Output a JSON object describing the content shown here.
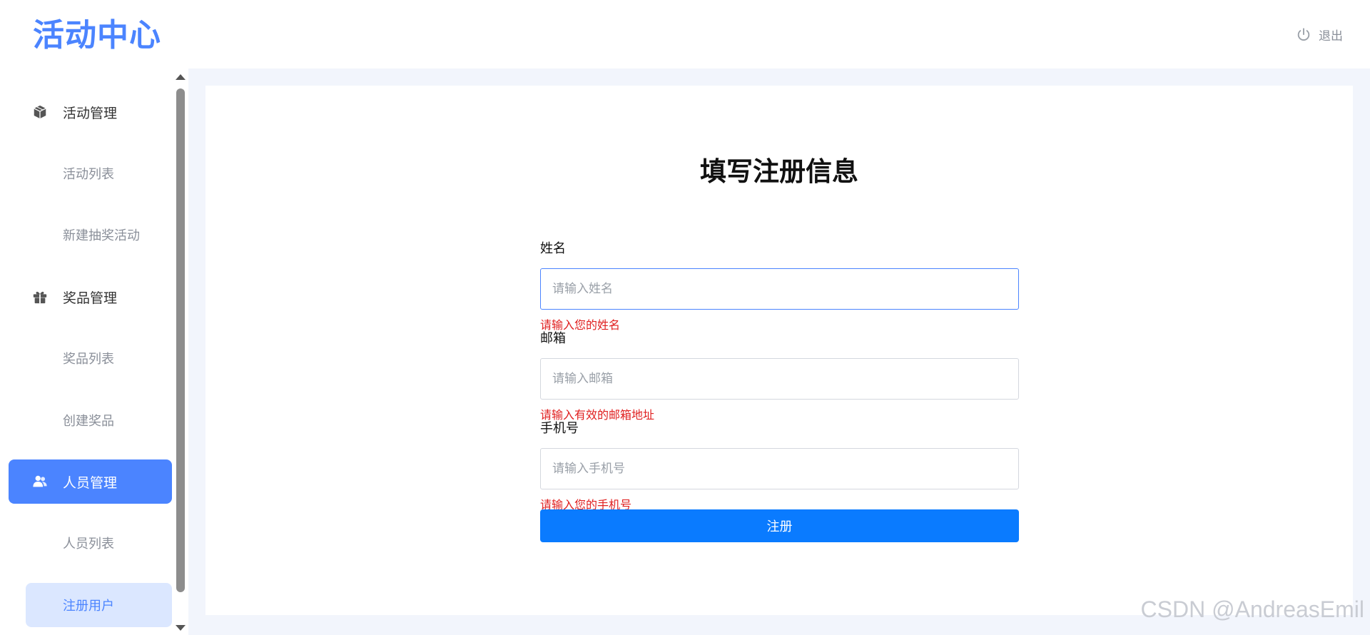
{
  "header": {
    "logo_text": "活动中心",
    "logout_label": "退出"
  },
  "sidebar": {
    "groups": [
      {
        "label": "活动管理",
        "icon": "cube-icon",
        "items": [
          "活动列表",
          "新建抽奖活动"
        ]
      },
      {
        "label": "奖品管理",
        "icon": "gift-icon",
        "items": [
          "奖品列表",
          "创建奖品"
        ]
      },
      {
        "label": "人员管理",
        "icon": "users-icon",
        "items": [
          "人员列表",
          "注册用户"
        ]
      }
    ],
    "active_group": "人员管理",
    "selected_item": "注册用户"
  },
  "form": {
    "title": "填写注册信息",
    "name": {
      "label": "姓名",
      "placeholder": "请输入姓名",
      "value": "",
      "error": "请输入您的姓名"
    },
    "email": {
      "label": "邮箱",
      "placeholder": "请输入邮箱",
      "value": "",
      "error": "请输入有效的邮箱地址"
    },
    "phone": {
      "label": "手机号",
      "placeholder": "请输入手机号",
      "value": "",
      "error": "请输入您的手机号"
    },
    "submit_label": "注册"
  },
  "watermark": "CSDN @AndreasEmil",
  "colors": {
    "accent": "#4b84ff",
    "button": "#0a7bff",
    "error": "#e02020",
    "background": "#f2f5fc"
  }
}
